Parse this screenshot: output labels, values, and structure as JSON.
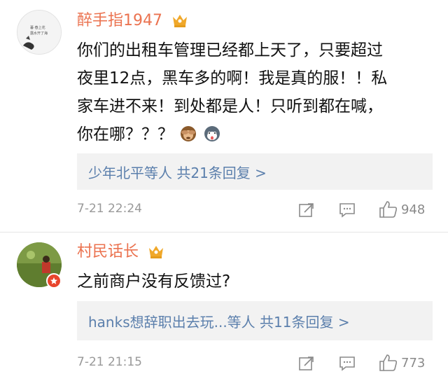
{
  "comments": [
    {
      "username": "醉手指1947",
      "text_lines": [
        "你们的出租车管理已经都上天了，只要超过",
        "夜里12点，黑车多的啊！我是真的服！！私",
        "家车进不来！到处都是人！只听到都在喊，",
        "你在哪？？？"
      ],
      "emojis": [
        "see-no-evil-monkey-emoji",
        "husky-dog-emoji"
      ],
      "replies_summary": "少年北平等人  共21条回复 >",
      "timestamp": "7-21 22:24",
      "likes": "948",
      "avatar_caption": "暮·春上花 露水开了海"
    },
    {
      "username": "村民话长",
      "text_lines": [
        "之前商户没有反馈过?"
      ],
      "replies_summary": "hanks想辞职出去玩...等人  共11条回复 >",
      "timestamp": "7-21 21:15",
      "likes": "773"
    }
  ],
  "colors": {
    "username": "#eb7350",
    "link": "#5b7fac",
    "meta": "#999999",
    "reply_bg": "#f2f2f2",
    "crown": "#f0a82a",
    "badge": "#e8452c"
  },
  "icons": [
    "crown-icon",
    "share-icon",
    "comment-icon",
    "like-icon",
    "verified-badge-icon"
  ]
}
